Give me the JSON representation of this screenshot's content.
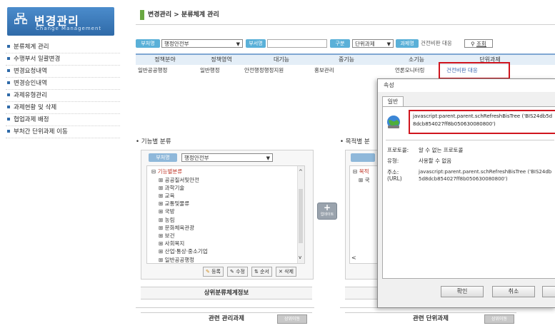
{
  "logo": {
    "title": "변경관리",
    "subtitle": "Change Management"
  },
  "sidebar": {
    "items": [
      {
        "label": "분류체계 관리"
      },
      {
        "label": "수행부서 일괄변경"
      },
      {
        "label": "변경요청내역"
      },
      {
        "label": "변경승인내역"
      },
      {
        "label": "과제유형관리"
      },
      {
        "label": "과제현황 및 삭제"
      },
      {
        "label": "협업과제 배정"
      },
      {
        "label": "부처간 단위과제 이동"
      }
    ]
  },
  "breadcrumb": "변경관리 > 분류체계 관리",
  "filter": {
    "ministry_tag": "부처명",
    "ministry_value": "행정안전부",
    "dept_tag": "부서명",
    "type_tag": "구분",
    "type_value": "단위과제",
    "task_tag": "과제명",
    "task_value": "건전비판 대응",
    "search_label": "조회"
  },
  "table": {
    "headers": [
      "정책분야",
      "정책영역",
      "대기능",
      "중기능",
      "소기능",
      "단위과제"
    ],
    "row": [
      "일반공공행정",
      "일반행정",
      "안전행정행정지원",
      "홍보관리",
      "언론모니터링",
      "건전비판 대응"
    ]
  },
  "dialog": {
    "title": "속성",
    "tab": "일반",
    "address_big": "javascript:parent.parent.schRefreshBisTree ('BIS24db5d8dcb854027ff8b050630080800')",
    "protocol_label": "프로토콜:",
    "protocol_value": "알 수 없는 프로토콜",
    "type_label": "유형:",
    "type_value": "사용할 수 없음",
    "addr_label": "주소:",
    "addr_sub": "(URL)",
    "addr_value": "javascript:parent.parent.schRefreshBisTree ('BIS24db5d8dcb854027ff8b050630080800')",
    "ok": "확인",
    "cancel": "취소"
  },
  "func": {
    "section": "• 기능별 분류",
    "tag": "부처명",
    "ministry": "행정안전부",
    "root": "기능별분류",
    "items": [
      "공공질서및안전",
      "과학기술",
      "교육",
      "교통및물류",
      "국방",
      "농림",
      "문화체육관광",
      "보건",
      "사회복지",
      "산업·통상·중소기업",
      "일반공공행정"
    ],
    "btns": [
      "등록",
      "수정",
      "순서",
      "삭제"
    ],
    "upper_bar": "상위분류체계정보",
    "related_bar": "관련 관리과제"
  },
  "purpose": {
    "section": "• 목적별 분",
    "root": "목적",
    "related_bar": "관련 단위과제"
  },
  "move_btn": "업데이트",
  "gray_btn": "상위이동"
}
